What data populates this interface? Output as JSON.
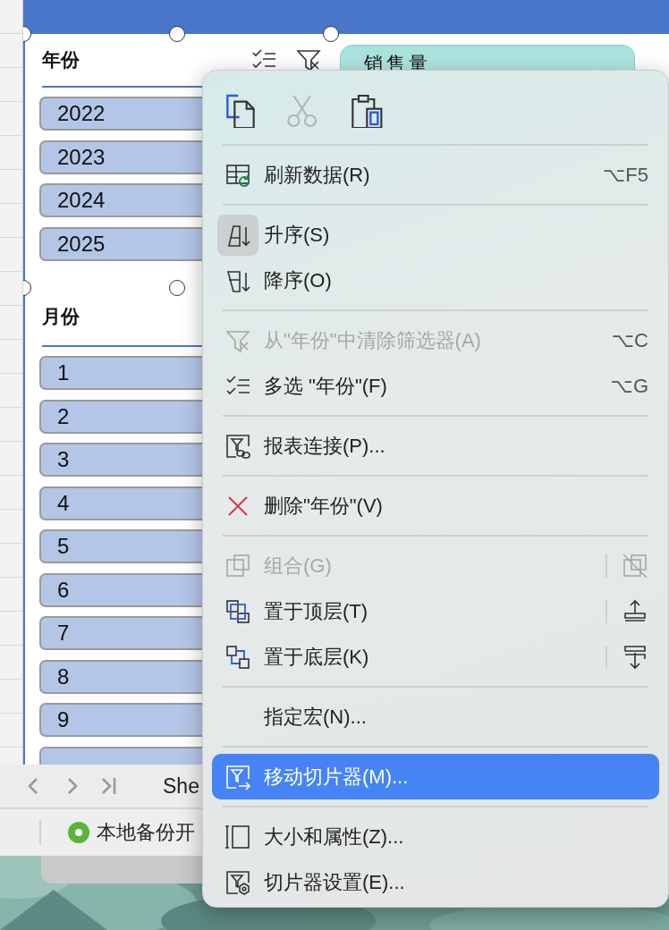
{
  "slicers": [
    {
      "title": "年份",
      "items": [
        {
          "label": "2022",
          "selected": true
        },
        {
          "label": "2023",
          "selected": true
        },
        {
          "label": "2024",
          "selected": true
        },
        {
          "label": "2025",
          "selected": true
        }
      ]
    },
    {
      "title": "月份",
      "items": [
        {
          "label": "1",
          "selected": true
        },
        {
          "label": "2",
          "selected": true
        },
        {
          "label": "3",
          "selected": true
        },
        {
          "label": "4",
          "selected": true
        },
        {
          "label": "5",
          "selected": true
        },
        {
          "label": "6",
          "selected": true
        },
        {
          "label": "7",
          "selected": true
        },
        {
          "label": "8",
          "selected": true
        },
        {
          "label": "9",
          "selected": true
        },
        {
          "selected": true
        }
      ]
    }
  ],
  "sales_slicer": {
    "title": "销售量"
  },
  "sheet_tabs": {
    "first_tab": "She"
  },
  "status_bar": {
    "backup_status": "本地备份开"
  },
  "context_menu": {
    "toolbar": [
      {
        "kind": "copy",
        "disabled": false
      },
      {
        "kind": "cut",
        "disabled": true
      },
      {
        "kind": "paste",
        "disabled": false
      }
    ],
    "groups": [
      [
        {
          "label": "刷新数据(R)",
          "kind": "refresh",
          "shortcut": "⌥F5",
          "disabled": false,
          "selected": false,
          "pressed": false
        }
      ],
      [
        {
          "label": "升序(S)",
          "kind": "sort_asc",
          "disabled": false,
          "selected": false,
          "pressed": true
        },
        {
          "label": "降序(O)",
          "kind": "sort_desc",
          "disabled": false,
          "selected": false,
          "pressed": false
        }
      ],
      [
        {
          "label": "从\"年份\"中清除筛选器(A)",
          "kind": "clear_filter",
          "shortcut": "⌥C",
          "disabled": true,
          "selected": false,
          "pressed": false
        },
        {
          "label": "多选 \"年份\"(F)",
          "kind": "multi_select",
          "shortcut": "⌥G",
          "disabled": false,
          "selected": false,
          "pressed": false
        }
      ],
      [
        {
          "label": "报表连接(P)...",
          "kind": "report_link",
          "disabled": false,
          "selected": false,
          "pressed": false
        }
      ],
      [
        {
          "label": "删除\"年份\"(V)",
          "kind": "delete",
          "disabled": false,
          "selected": false,
          "pressed": false
        }
      ],
      [
        {
          "label": "组合(G)",
          "kind": "group",
          "disabled": true,
          "selected": false,
          "pressed": false
        },
        {
          "label": "置于顶层(T)",
          "kind": "front",
          "disabled": false,
          "selected": false,
          "pressed": false
        },
        {
          "label": "置于底层(K)",
          "kind": "back",
          "disabled": false,
          "selected": false,
          "pressed": false
        }
      ],
      [
        {
          "label": "指定宏(N)...",
          "kind": "macro",
          "disabled": false,
          "selected": false,
          "pressed": false
        }
      ],
      [
        {
          "label": "移动切片器(M)...",
          "kind": "move",
          "disabled": false,
          "selected": true,
          "pressed": false
        }
      ],
      [
        {
          "label": "大小和属性(Z)...",
          "kind": "size",
          "disabled": false,
          "selected": false,
          "pressed": false
        },
        {
          "label": "切片器设置(E)...",
          "kind": "settings",
          "disabled": false,
          "selected": false,
          "pressed": false
        }
      ]
    ]
  }
}
